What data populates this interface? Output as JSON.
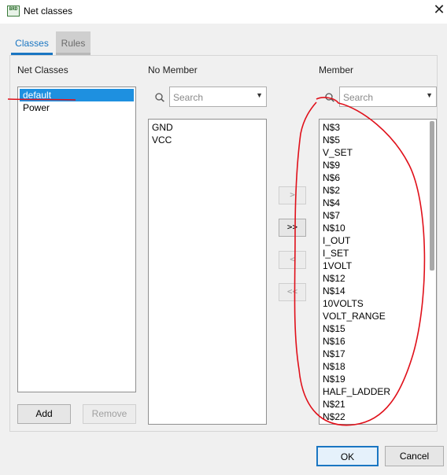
{
  "window": {
    "title": "Net classes",
    "app_icon_text": "BRD"
  },
  "tabs": [
    {
      "label": "Classes"
    },
    {
      "label": "Rules"
    }
  ],
  "net_classes": {
    "label": "Net Classes",
    "items": [
      "default",
      "Power"
    ],
    "selected": "default",
    "add_label": "Add",
    "remove_label": "Remove"
  },
  "no_member": {
    "label": "No Member",
    "search_placeholder": "Search",
    "items": [
      "GND",
      "VCC"
    ]
  },
  "member": {
    "label": "Member",
    "search_placeholder": "Search",
    "items": [
      "N$3",
      "N$5",
      "V_SET",
      "N$9",
      "N$6",
      "N$2",
      "N$4",
      "N$7",
      "N$10",
      "I_OUT",
      "I_SET",
      "1VOLT",
      "N$12",
      "N$14",
      "10VOLTS",
      "VOLT_RANGE",
      "N$15",
      "N$16",
      "N$17",
      "N$18",
      "N$19",
      "HALF_LADDER",
      "N$21",
      "N$22"
    ]
  },
  "move_buttons": {
    "add_one": ">",
    "add_all": ">>",
    "remove_one": "<",
    "remove_all": "<<"
  },
  "footer": {
    "ok_label": "OK",
    "cancel_label": "Cancel"
  },
  "colors": {
    "accent": "#1a76c2",
    "selection": "#1e90e0",
    "annotation": "#e0101a"
  }
}
